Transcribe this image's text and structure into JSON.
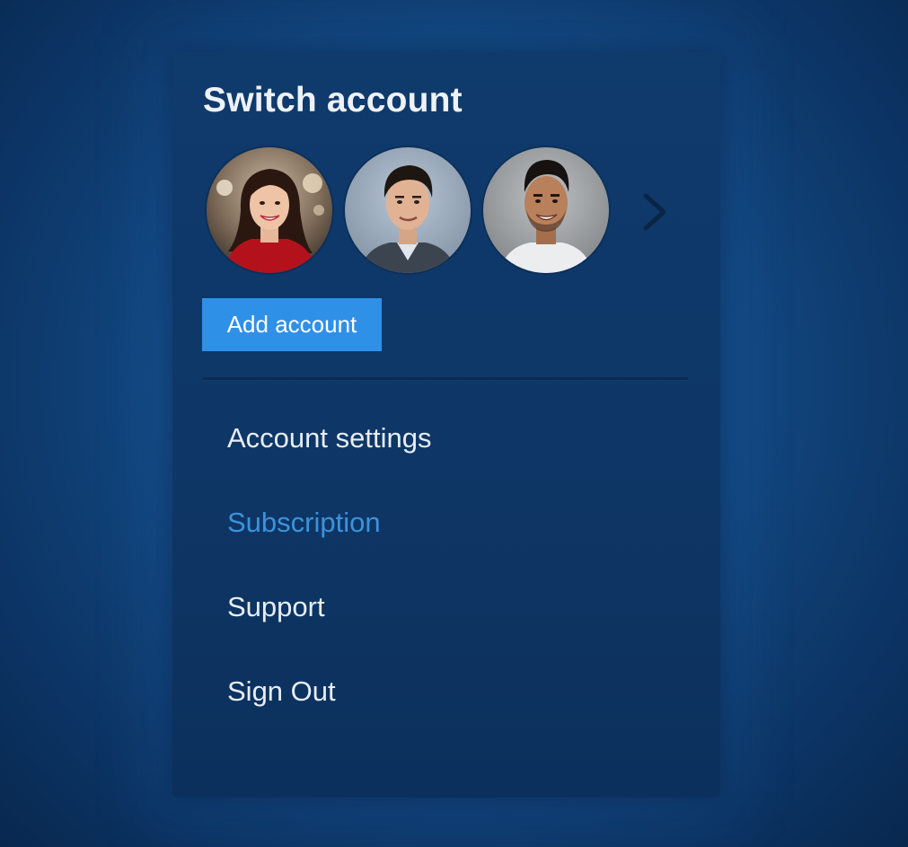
{
  "panel": {
    "title": "Switch account"
  },
  "accounts": [
    {
      "avatar": "woman-red-top-avatar"
    },
    {
      "avatar": "man-suit-avatar"
    },
    {
      "avatar": "man-smiling-avatar"
    }
  ],
  "icons": {
    "next": "chevron-right-icon"
  },
  "add_account_label": "Add account",
  "menu": {
    "items": [
      {
        "label": "Account settings"
      },
      {
        "label": "Subscription",
        "active": true
      },
      {
        "label": "Support"
      },
      {
        "label": "Sign Out"
      }
    ]
  },
  "colors": {
    "background": "#134a84",
    "panel": "#0e3767",
    "button": "#2f90e8",
    "active_link": "#3a93dc",
    "text": "#e8edf5"
  }
}
